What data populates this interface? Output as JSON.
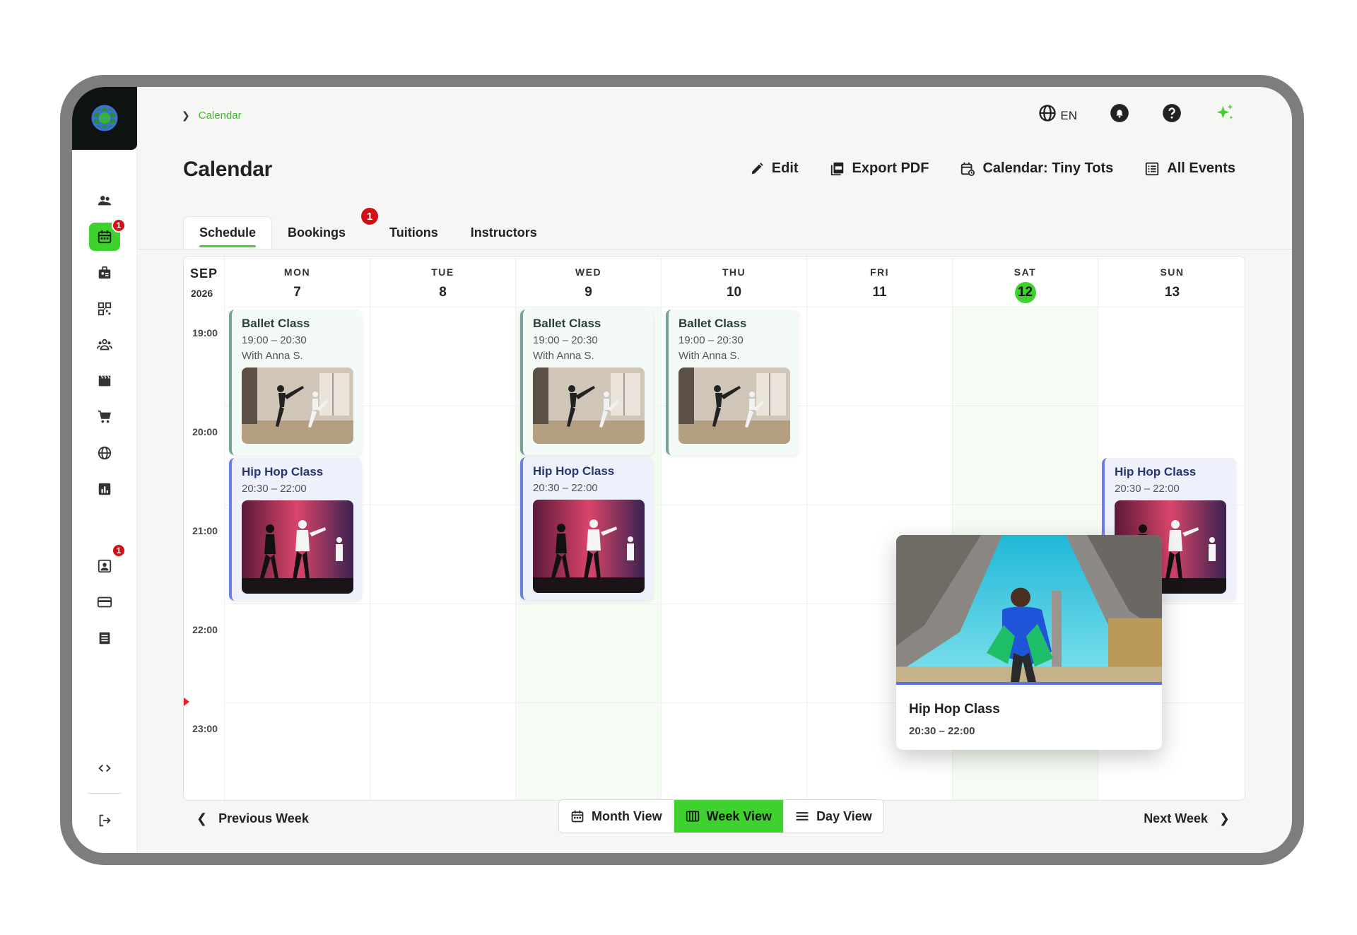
{
  "colors": {
    "accent": "#3fd12e",
    "badge": "#d40f14",
    "now_line": "#e32222",
    "hiphop_border": "#6b7fe8",
    "ballet_border": "#79a09a"
  },
  "breadcrumb": {
    "current": "Calendar"
  },
  "topbar": {
    "language": "EN"
  },
  "page": {
    "title": "Calendar"
  },
  "actions": {
    "edit": "Edit",
    "export_pdf": "Export PDF",
    "calendar_select": "Calendar: Tiny Tots",
    "all_events": "All Events"
  },
  "tabs": [
    {
      "label": "Schedule",
      "active": true
    },
    {
      "label": "Bookings",
      "badge": "1"
    },
    {
      "label": "Tuitions"
    },
    {
      "label": "Instructors"
    }
  ],
  "sidebar": {
    "badges": {
      "calendar": "1",
      "contacts": "1"
    },
    "items": [
      "users-icon",
      "calendar-icon",
      "badge-icon",
      "qr-icon",
      "group-icon",
      "clapper-icon",
      "cart-icon",
      "globe-icon",
      "chart-icon",
      "contact-card-icon",
      "credit-card-icon",
      "list-icon",
      "code-icon",
      "logout-icon"
    ]
  },
  "calendar": {
    "month": "SEP",
    "year": "2026",
    "hours": [
      "19:00",
      "20:00",
      "21:00",
      "22:00",
      "23:00"
    ],
    "days": [
      {
        "dow": "MON",
        "num": "7"
      },
      {
        "dow": "TUE",
        "num": "8"
      },
      {
        "dow": "WED",
        "num": "9"
      },
      {
        "dow": "THU",
        "num": "10"
      },
      {
        "dow": "FRI",
        "num": "11"
      },
      {
        "dow": "SAT",
        "num": "12",
        "today": true
      },
      {
        "dow": "SUN",
        "num": "13"
      }
    ],
    "events": {
      "ballet": {
        "title": "Ballet Class",
        "time": "19:00 – 20:30",
        "with": "With Anna S."
      },
      "hiphop": {
        "title": "Hip Hop Class",
        "time": "20:30 – 22:00"
      }
    },
    "popup": {
      "title": "Hip Hop Class",
      "time": "20:30 – 22:00"
    }
  },
  "footer": {
    "prev": "Previous Week",
    "next": "Next Week",
    "views": [
      {
        "label": "Month View"
      },
      {
        "label": "Week View",
        "active": true
      },
      {
        "label": "Day View"
      }
    ]
  }
}
